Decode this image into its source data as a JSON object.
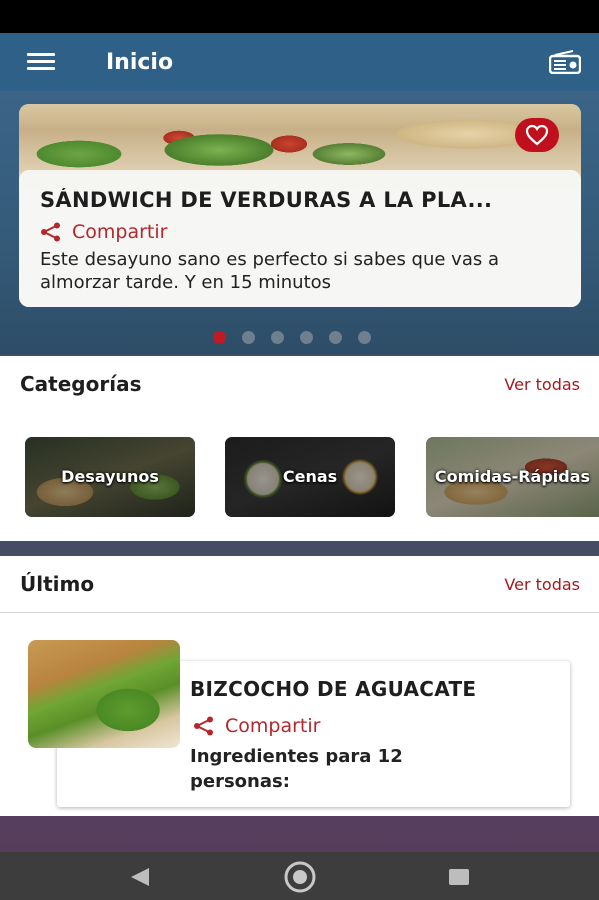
{
  "app": {
    "title": "Inicio",
    "menu_icon": "hamburger-menu-icon",
    "radio_icon": "radio-icon",
    "colors": {
      "primary": "#2f6188",
      "accent": "#b3272d",
      "heart": "#c0101e"
    }
  },
  "banner": {
    "title": "SÁNDWICH DE VERDURAS A LA PLA...",
    "share_label": "Compartir",
    "description": "Este desayuno sano es perfecto si sabes que vas a almorzar tarde. Y en 15 minutos",
    "favorite_icon": "heart-icon",
    "slides_total": 6,
    "active_slide": 1
  },
  "categories": {
    "title": "Categorías",
    "see_all": "Ver todas",
    "items": [
      {
        "label": "Desayunos"
      },
      {
        "label": "Cenas"
      },
      {
        "label": "Comidas-Rápidas"
      }
    ]
  },
  "latest": {
    "title": "Último",
    "see_all": "Ver todas",
    "items": [
      {
        "title": "BIZCOCHO DE AGUACATE",
        "share_label": "Compartir",
        "description": "Ingredientes para 12 personas:"
      }
    ]
  },
  "navigation": {
    "back_icon": "back-triangle-icon",
    "home_icon": "home-circle-icon",
    "recents_icon": "recents-square-icon"
  }
}
